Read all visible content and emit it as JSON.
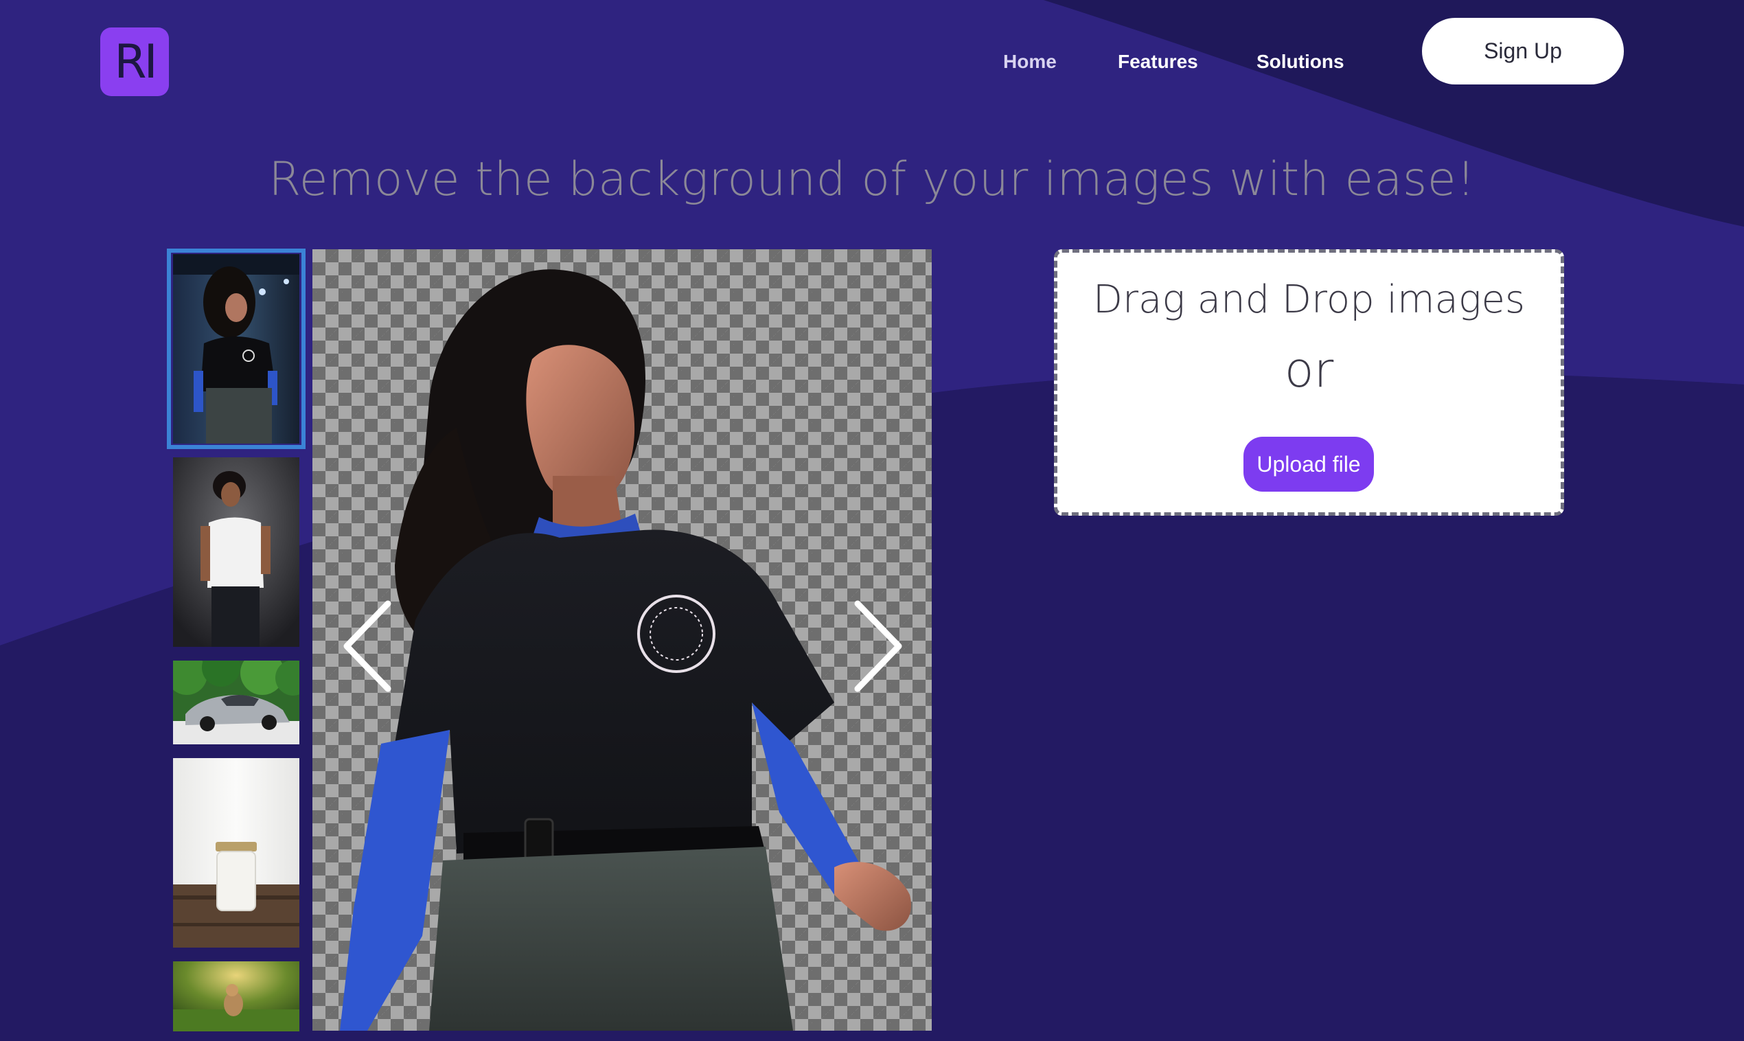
{
  "header": {
    "logo_text": "RI",
    "nav": [
      {
        "label": "Home",
        "active": true
      },
      {
        "label": "Features",
        "active": false
      },
      {
        "label": "Solutions",
        "active": false
      }
    ],
    "signup_label": "Sign Up"
  },
  "hero": {
    "headline": "Remove the background of your images with ease!"
  },
  "gallery": {
    "thumbnails": [
      {
        "subject": "woman-curly-hair-black-tshirt",
        "selected": true
      },
      {
        "subject": "man-white-tshirt",
        "selected": false
      },
      {
        "subject": "silver-sports-car",
        "selected": false
      },
      {
        "subject": "milk-jar",
        "selected": false
      },
      {
        "subject": "dog-in-grass",
        "selected": false
      }
    ],
    "prev_icon": "chevron-left-icon",
    "next_icon": "chevron-right-icon"
  },
  "upload": {
    "title": "Drag and Drop images",
    "or_text": "or",
    "button_label": "Upload file"
  },
  "colors": {
    "background": "#251c66",
    "brand": "#8a3ff0",
    "upload_button": "#7d3cf0",
    "selected_border": "#3b83d6",
    "headline": "#8b8897"
  }
}
